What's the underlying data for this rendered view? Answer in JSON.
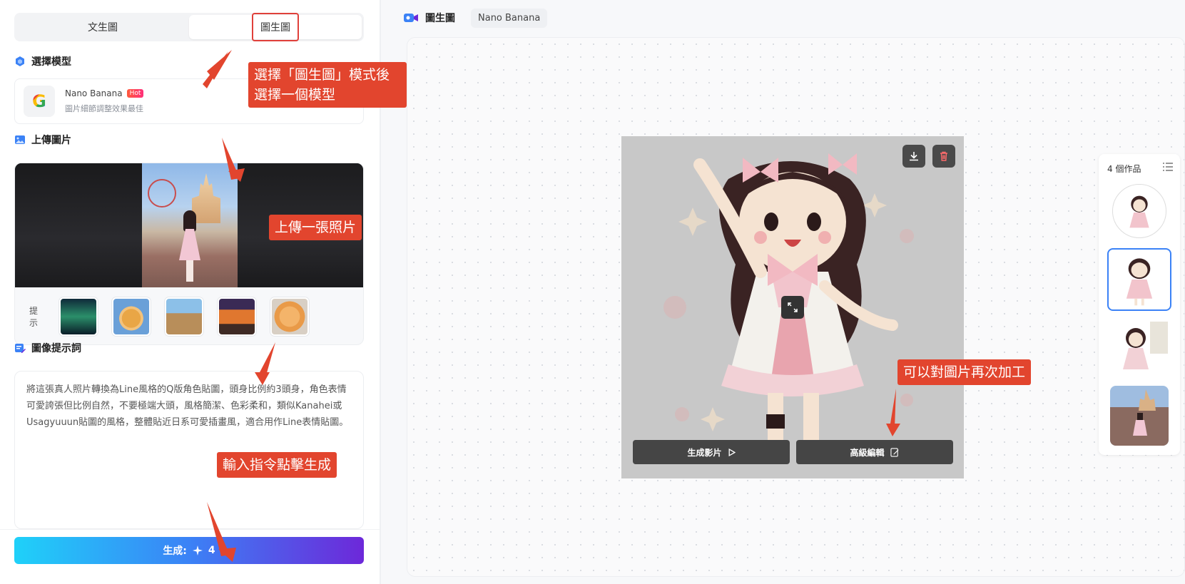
{
  "left": {
    "mode_tabs": [
      {
        "label": "文生圖"
      },
      {
        "label": "圖生圖"
      }
    ],
    "model_section": {
      "title": "選擇模型",
      "model_name": "Nano Banana",
      "badge": "Hot",
      "model_desc": "圖片細節調整效果最佳",
      "logo_letter": "G"
    },
    "upload_section": {
      "title": "上傳圖片",
      "hint_label": "提示"
    },
    "prompt_section": {
      "title": "圖像提示詞",
      "text": "將這張真人照片轉換為Line風格的Q版角色貼圖，頭身比例約3頭身，角色表情可愛誇張但比例自然，不要極端大頭，風格簡潔、色彩柔和，類似Kanahei或Usagyuuun貼圖的風格，整體貼近日系可愛插畫風，適合用作Line表情貼圖。"
    },
    "generate_button": {
      "label": "生成:",
      "cost": "4"
    }
  },
  "right": {
    "page_label": "圖生圖",
    "model_chip": "Nano Banana",
    "result_actions": {
      "video": "生成影片",
      "edit": "高級編輯"
    },
    "works": {
      "title": "4 個作品"
    }
  },
  "annotations": {
    "note1": "選擇「圖生圖」模式後選擇一個模型",
    "note2": "上傳一張照片",
    "note3": "輸入指令點擊生成",
    "note4": "可以對圖片再次加工"
  },
  "colors": {
    "accent_red": "#e2452e",
    "primary_blue": "#3b82f6",
    "gradient_start": "#1fd1f9",
    "gradient_end": "#6d28d9"
  }
}
